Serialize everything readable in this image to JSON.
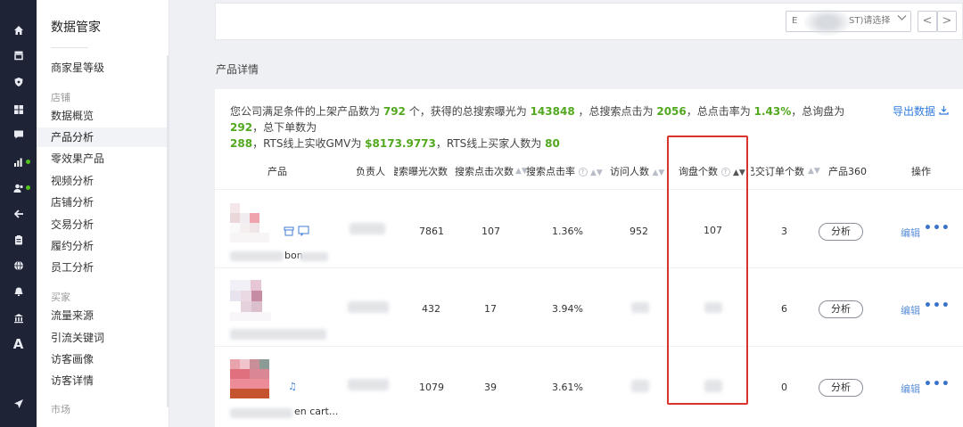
{
  "rail": {
    "icons": [
      "home-icon",
      "shop-icon",
      "shield-icon",
      "apps-icon",
      "message-icon",
      "chart-icon",
      "users-icon",
      "back-arrow-icon",
      "clipboard-icon",
      "globe-icon",
      "bell-icon",
      "bank-icon",
      "font-a-icon",
      "send-icon"
    ],
    "status_color": "#52c41a"
  },
  "menu": {
    "title": "数据管家",
    "top_item": "商家星等级",
    "groups": [
      {
        "label": "店铺",
        "items": [
          "数据概览",
          "产品分析",
          "零效果产品",
          "视频分析",
          "店铺分析",
          "交易分析",
          "履约分析",
          "员工分析"
        ]
      },
      {
        "label": "买家",
        "items": [
          "流量来源",
          "引流关键词",
          "访客画像",
          "访客详情"
        ]
      },
      {
        "label": "市场",
        "items": []
      }
    ],
    "active_item": "产品分析"
  },
  "topbar": {
    "select_text": "ST)请选择",
    "select_prefix": "E",
    "prev_label": "<",
    "next_label": ">"
  },
  "section_title": "产品详情",
  "summary": {
    "t1": "您公司满足条件的上架产品数为",
    "products": "792",
    "t2": "个，获得的总搜索曝光为",
    "exposure": "143848",
    "t3": "，总搜索点击为",
    "clicks": "2056",
    "t4": "，总点击率为",
    "ctr": "1.43%",
    "t5": "，总询盘为",
    "inquiries": "292",
    "t6": "，总下单数为",
    "orders": "288",
    "t7": "，RTS线上实收GMV为",
    "gmv": "$8173.9773",
    "t8": "，RTS线上买家人数为",
    "buyers": "80"
  },
  "export_label": "导出数据",
  "table": {
    "headers": {
      "product": "产品",
      "owner": "负责人",
      "exposure": "搜索曝光次数",
      "clicks": "搜索点击次数",
      "ctr": "搜索点击率",
      "visitors": "访问人数",
      "inquiries": "询盘个数",
      "orders": "已交订单个数",
      "p360": "产品360",
      "actions": "操作"
    },
    "rows": [
      {
        "name_suffix": "bon",
        "exposure": "7861",
        "clicks": "107",
        "ctr": "1.36%",
        "visitors": "952",
        "inquiries": "107",
        "orders": "3"
      },
      {
        "name_suffix": "",
        "exposure": "432",
        "clicks": "17",
        "ctr": "3.94%",
        "visitors": "",
        "inquiries": "",
        "orders": "6"
      },
      {
        "name_suffix": "en cart...",
        "exposure": "1079",
        "clicks": "39",
        "ctr": "3.61%",
        "visitors": "",
        "inquiries": "",
        "orders": "0"
      }
    ],
    "analyze_label": "分析",
    "edit_label": "编辑",
    "more_label": "•••"
  },
  "colors": {
    "highlight": "#d9342b",
    "accent_green": "#52a81e",
    "link_blue": "#2f7be0"
  }
}
